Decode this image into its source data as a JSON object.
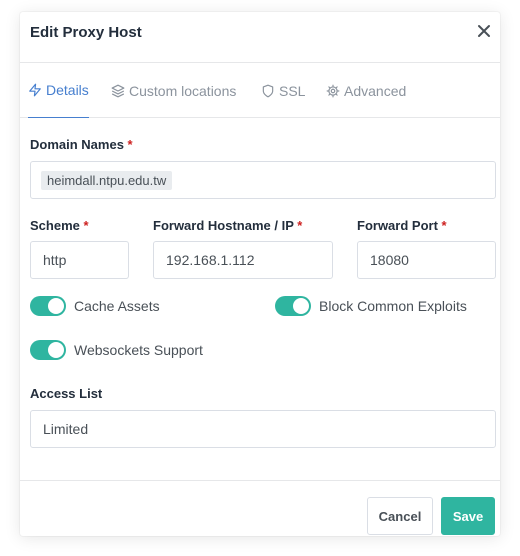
{
  "modal": {
    "title": "Edit Proxy Host"
  },
  "tabs": [
    {
      "label": "Details",
      "icon": "zap-icon",
      "active": true
    },
    {
      "label": "Custom locations",
      "icon": "layers-icon"
    },
    {
      "label": "SSL",
      "icon": "shield-icon"
    },
    {
      "label": "Advanced",
      "icon": "gear-icon"
    }
  ],
  "form": {
    "domain_names_label": "Domain Names",
    "domain_chip": "heimdall.ntpu.edu.tw",
    "scheme_label": "Scheme",
    "scheme_value": "http",
    "hostname_label": "Forward Hostname / IP",
    "hostname_value": "192.168.1.112",
    "port_label": "Forward Port",
    "port_value": "18080",
    "required_mark": "*",
    "cache_assets_label": "Cache Assets",
    "cache_assets_on": true,
    "block_exploits_label": "Block Common Exploits",
    "block_exploits_on": true,
    "websockets_label": "Websockets Support",
    "websockets_on": true,
    "access_list_label": "Access List",
    "access_list_value": "Limited"
  },
  "footer": {
    "cancel_label": "Cancel",
    "save_label": "Save"
  },
  "colors": {
    "accent_blue": "#467fcf",
    "toggle_teal": "#2fb5a0",
    "required_red": "#cd201f"
  }
}
